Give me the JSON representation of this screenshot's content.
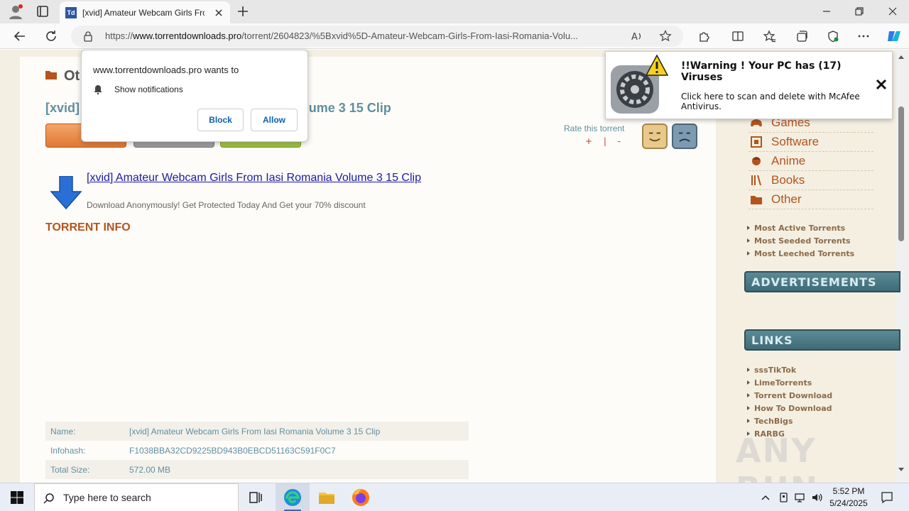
{
  "browser": {
    "tab_title": "[xvid] Amateur Webcam Girls Fro",
    "tab_favicon_text": "Td",
    "url_prefix": "https://",
    "url_host": "www.torrentdownloads.pro",
    "url_path": "/torrent/2604823/%5Bxvid%5D-Amateur-Webcam-Girls-From-Iasi-Romania-Volu..."
  },
  "page": {
    "category_title": "Ot",
    "torrent_title": "[xvid] Amateur Webcam Girls From Iasi Romania Volume 3 15 Clip",
    "torrent_title_visible_left": "[xvid]",
    "torrent_title_visible_right": "omania Volume 3 15 Clip",
    "rate_label": "Rate this torrent",
    "rate_pm": "+ | -",
    "download_link": "[xvid] Amateur Webcam Girls From Iasi Romania Volume 3 15 Clip",
    "download_sub": "Download Anonymously! Get Protected Today And Get your 70% discount",
    "torrent_info_heading": "TORRENT INFO",
    "info_rows": [
      {
        "k": "Name:",
        "v": "[xvid] Amateur Webcam Girls From Iasi Romania Volume 3 15 Clip"
      },
      {
        "k": "Infohash:",
        "v": "F1038BBA32CD9225BD943B0EBCD51163C591F0C7"
      },
      {
        "k": "Total Size:",
        "v": "572.00 MB"
      }
    ]
  },
  "sidebar": {
    "categories": [
      "Games",
      "Software",
      "Anime",
      "Books",
      "Other"
    ],
    "top_links": [
      "Most Active Torrents",
      "Most Seeded Torrents",
      "Most Leeched Torrents"
    ],
    "ads_heading": "ADVERTISEMENTS",
    "links_heading": "LINKS",
    "links": [
      "sssTikTok",
      "LimeTorrents",
      "Torrent Download",
      "How To Download",
      "TechBigs",
      "RARBG"
    ]
  },
  "notification": {
    "site": "www.torrentdownloads.pro wants to",
    "permission": "Show notifications",
    "block": "Block",
    "allow": "Allow"
  },
  "warning": {
    "title": "!!Warning ! Your PC has (17) Viruses",
    "body": "Click here to scan and delete with McAfee Antivirus."
  },
  "taskbar": {
    "search_placeholder": "Type here to search",
    "time": "5:52 PM",
    "date": "5/24/2025"
  },
  "watermark": "ANY RUN"
}
